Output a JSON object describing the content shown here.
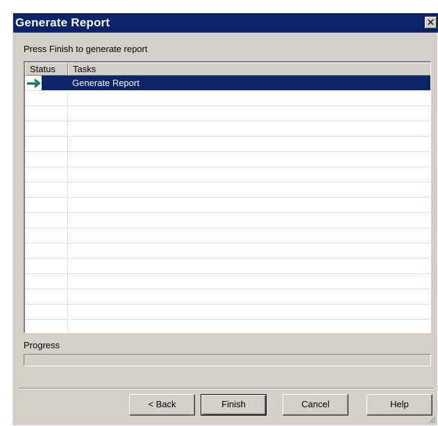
{
  "window": {
    "title": "Generate Report",
    "close_glyph": "✕"
  },
  "instruction": "Press Finish to generate report",
  "list": {
    "columns": [
      "Status",
      "Tasks"
    ],
    "rows": [
      {
        "status_icon": "arrow-right-icon",
        "task": "Generate Report",
        "selected": true
      }
    ],
    "empty_rows": 16
  },
  "progress": {
    "label": "Progress",
    "value": 0
  },
  "buttons": {
    "back": "< Back",
    "finish": "Finish",
    "cancel": "Cancel",
    "help": "Help"
  },
  "colors": {
    "titlebar": "#0a246a",
    "selection": "#0a246a",
    "dialog_bg": "#d4d0c8",
    "arrow": "#1f7a5a"
  }
}
